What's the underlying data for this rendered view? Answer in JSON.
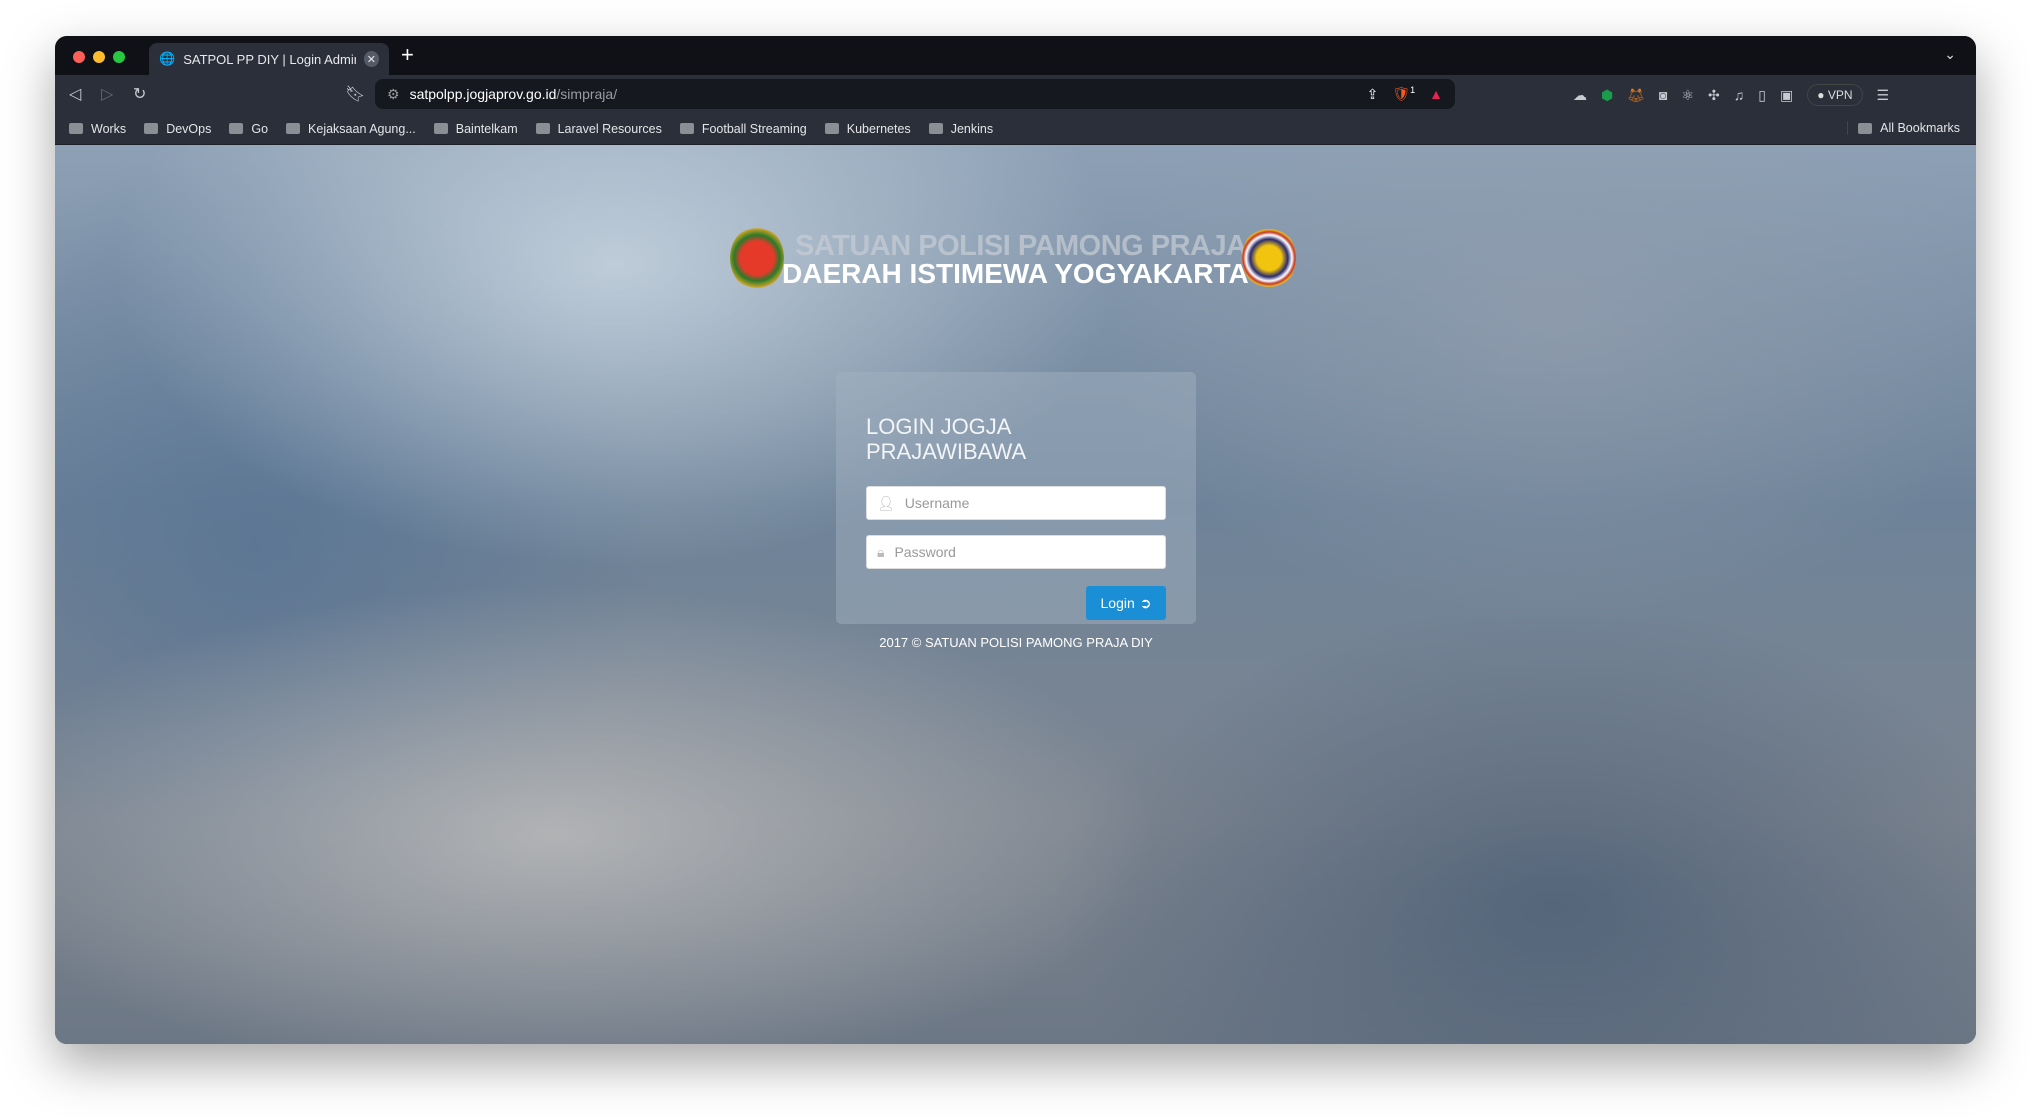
{
  "browser": {
    "tab_title": "SATPOL PP DIY | Login Administrator",
    "url_host": "satpolpp.jogjaprov.go.id",
    "url_path": "/simpraja/",
    "shield_badge": "1",
    "vpn_label": "VPN",
    "bookmarks": [
      "Works",
      "DevOps",
      "Go",
      "Kejaksaan Agung...",
      "Baintelkam",
      "Laravel Resources",
      "Football Streaming",
      "Kubernetes",
      "Jenkins"
    ],
    "all_bookmarks": "All Bookmarks"
  },
  "header": {
    "line1": "SATUAN POLISI PAMONG PRAJA",
    "line2": "DAERAH ISTIMEWA YOGYAKARTA"
  },
  "login": {
    "title": "LOGIN JOGJA PRAJAWIBAWA",
    "username_placeholder": "Username",
    "password_placeholder": "Password",
    "button": "Login",
    "accent": "#1b8fd6"
  },
  "footer": "2017 © SATUAN POLISI PAMONG PRAJA DIY"
}
